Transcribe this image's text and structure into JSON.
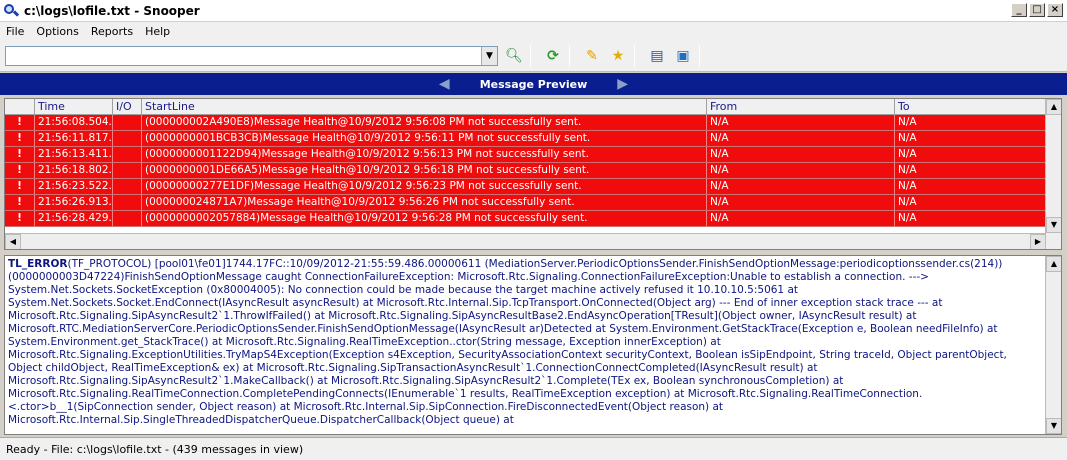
{
  "window": {
    "title": "c:\\logs\\lofile.txt - Snooper"
  },
  "menu": [
    "File",
    "Options",
    "Reports",
    "Help"
  ],
  "toolbar": {
    "search_value": "",
    "icons": [
      "search-icon",
      "refresh-icon",
      "edit-icon",
      "bookmark-icon",
      "view-icon",
      "export-icon"
    ]
  },
  "preview": {
    "title": "Message Preview"
  },
  "grid": {
    "columns": [
      "Time",
      "I/O",
      "StartLine",
      "From",
      "To"
    ],
    "rows": [
      {
        "flag": "!",
        "time": "21:56:08.504.",
        "io": "",
        "startline": "(000000002A490E8)Message Health@10/9/2012 9:56:08 PM not successfully sent.",
        "from": "N/A",
        "to": "N/A"
      },
      {
        "flag": "!",
        "time": "21:56:11.817.",
        "io": "",
        "startline": "(0000000001BCB3CB)Message Health@10/9/2012 9:56:11 PM not successfully sent.",
        "from": "N/A",
        "to": "N/A"
      },
      {
        "flag": "!",
        "time": "21:56:13.411.",
        "io": "",
        "startline": "(0000000001122D94)Message Health@10/9/2012 9:56:13 PM not successfully sent.",
        "from": "N/A",
        "to": "N/A"
      },
      {
        "flag": "!",
        "time": "21:56:18.802.",
        "io": "",
        "startline": "(0000000001DE66A5)Message Health@10/9/2012 9:56:18 PM not successfully sent.",
        "from": "N/A",
        "to": "N/A"
      },
      {
        "flag": "!",
        "time": "21:56:23.522.",
        "io": "",
        "startline": "(00000000277E1DF)Message Health@10/9/2012 9:56:23 PM not successfully sent.",
        "from": "N/A",
        "to": "N/A"
      },
      {
        "flag": "!",
        "time": "21:56:26.913.",
        "io": "",
        "startline": "(000000024871A7)Message Health@10/9/2012 9:56:26 PM not successfully sent.",
        "from": "N/A",
        "to": "N/A"
      },
      {
        "flag": "!",
        "time": "21:56:28.429.",
        "io": "",
        "startline": "(0000000002057884)Message Health@10/9/2012 9:56:28 PM not successfully sent.",
        "from": "N/A",
        "to": "N/A"
      }
    ]
  },
  "detail": {
    "level": "TL_ERROR",
    "header": "(TF_PROTOCOL) [pool01\\fe01]1744.17FC::10/09/2012-21:55:59.486.00000611 (MediationServer.PeriodicOptionsSender.FinishSendOptionMessage:periodicoptionssender.cs(214))",
    "body": "(0000000003D47224)FinishSendOptionMessage caught ConnectionFailureException: Microsoft.Rtc.Signaling.ConnectionFailureException:Unable to establish a connection. ---> System.Net.Sockets.SocketException (0x80004005): No connection could be made because the target machine actively refused it 10.10.10.5:5061   at System.Net.Sockets.Socket.EndConnect(IAsyncResult asyncResult)   at Microsoft.Rtc.Internal.Sip.TcpTransport.OnConnected(Object arg)   --- End of inner exception stack trace --- at Microsoft.Rtc.Signaling.SipAsyncResult2`1.ThrowIfFailed()   at Microsoft.Rtc.Signaling.SipAsyncResultBase2.EndAsyncOperation[TResult](Object owner, IAsyncResult result)   at Microsoft.RTC.MediationServerCore.PeriodicOptionsSender.FinishSendOptionMessage(IAsyncResult ar)Detected at System.Environment.GetStackTrace(Exception e, Boolean needFileInfo)   at System.Environment.get_StackTrace()   at Microsoft.Rtc.Signaling.RealTimeException..ctor(String message, Exception innerException)   at Microsoft.Rtc.Signaling.ExceptionUtilities.TryMapS4Exception(Exception s4Exception, SecurityAssociationContext securityContext, Boolean isSipEndpoint, String traceId, Object parentObject, Object childObject, RealTimeException& ex)   at Microsoft.Rtc.Signaling.SipTransactionAsyncResult`1.ConnectionConnectCompleted(IAsyncResult result)   at Microsoft.Rtc.Signaling.SipAsyncResult2`1.MakeCallback()   at Microsoft.Rtc.Signaling.SipAsyncResult2`1.Complete(TEx ex, Boolean synchronousCompletion)   at Microsoft.Rtc.Signaling.RealTimeConnection.CompletePendingConnects(IEnumerable`1 results, RealTimeException exception)   at Microsoft.Rtc.Signaling.RealTimeConnection.<.ctor>b__1(SipConnection sender, Object reason)   at Microsoft.Rtc.Internal.Sip.SipConnection.FireDisconnectedEvent(Object reason)   at Microsoft.Rtc.Internal.Sip.SingleThreadedDispatcherQueue.DispatcherCallback(Object queue)   at"
  },
  "status": {
    "text": "Ready - File: c:\\logs\\lofile.txt - (439 messages in view)"
  }
}
